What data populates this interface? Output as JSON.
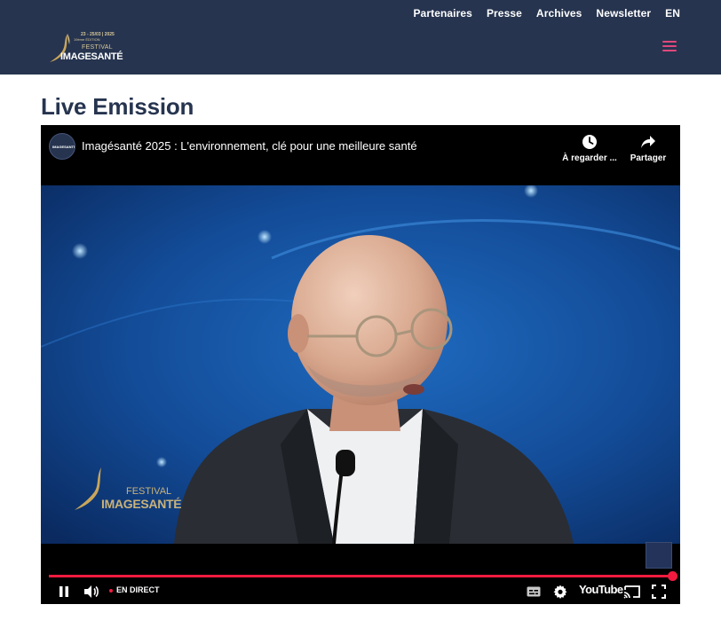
{
  "nav": {
    "links": [
      "Partenaires",
      "Presse",
      "Archives",
      "Newsletter",
      "EN"
    ]
  },
  "logo": {
    "dates": "23 - 25/03 | 2025",
    "edition": "19ème ÉDITION",
    "festival": "FESTIVAL",
    "brand": "IMAGESANTÉ"
  },
  "page": {
    "title": "Live Emission"
  },
  "player": {
    "video_title": "Imagésanté 2025 : L'environnement, clé pour une meilleure santé",
    "watch_later": "À regarder ...",
    "share": "Partager",
    "live_label": "EN DIRECT",
    "youtube_label": "YouTube",
    "progress": 1.0,
    "watermark_festival": "FESTIVAL",
    "watermark_brand": "IMAGESANTÉ"
  },
  "colors": {
    "header_bg": "#26344f",
    "title": "#26344f",
    "accent_pink": "#e0487a",
    "progress_red": "#f21b3f"
  }
}
